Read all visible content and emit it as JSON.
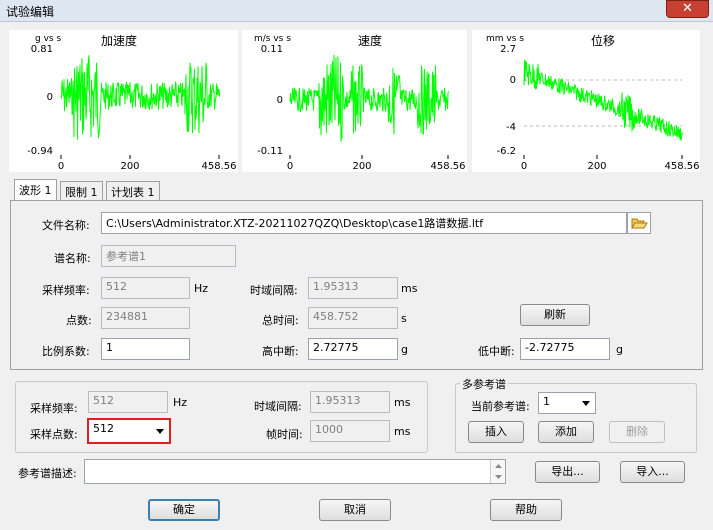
{
  "window": {
    "title": "试验编辑",
    "close_symbol": "✕"
  },
  "charts": [
    {
      "title": "加速度",
      "unit": "g vs s",
      "y_top": "0.81",
      "y_mid": "0",
      "y_bot": "-0.94",
      "x_ticks": [
        "0",
        "200",
        "458.56"
      ],
      "color": "#00ff00"
    },
    {
      "title": "速度",
      "unit": "m/s vs s",
      "y_top": "0.11",
      "y_mid": "0",
      "y_bot": "-0.11",
      "x_ticks": [
        "0",
        "200",
        "458.56"
      ],
      "color": "#00ff00"
    },
    {
      "title": "位移",
      "unit": "mm vs s",
      "y_top": "2.7",
      "y_mid": "0",
      "y_mid2": "-4",
      "y_bot": "-6.2",
      "x_ticks": [
        "0",
        "200",
        "458.56"
      ],
      "color": "#00ff00"
    }
  ],
  "tabs": [
    "波形 1",
    "限制 1",
    "计划表 1"
  ],
  "waveform": {
    "file_label": "文件名称:",
    "file_value": "C:\\Users\\Administrator.XTZ-20211027QZQ\\Desktop\\case1路谱数据.ltf",
    "spectrum_name_label": "谱名称:",
    "spectrum_name_value": "参考谱1",
    "sample_rate_label": "采样频率:",
    "sample_rate_value": "512",
    "sample_rate_unit": "Hz",
    "time_interval_label": "时域间隔:",
    "time_interval_value": "1.95313",
    "time_interval_unit": "ms",
    "points_label": "点数:",
    "points_value": "234881",
    "total_time_label": "总时间:",
    "total_time_value": "458.752",
    "total_time_unit": "s",
    "refresh_label": "刷新",
    "scale_label": "比例系数:",
    "scale_value": "1",
    "high_cut_label": "高中断:",
    "high_cut_value": "2.72775",
    "high_cut_unit": "g",
    "low_cut_label": "低中断:",
    "low_cut_value": "-2.72775",
    "low_cut_unit": "g"
  },
  "lower": {
    "sample_rate_label": "采样频率:",
    "sample_rate_value": "512",
    "sample_rate_unit": "Hz",
    "time_interval_label": "时域间隔:",
    "time_interval_value": "1.95313",
    "time_interval_unit": "ms",
    "sample_points_label": "采样点数:",
    "sample_points_value": "512",
    "frame_time_label": "帧时间:",
    "frame_time_value": "1000",
    "frame_time_unit": "ms"
  },
  "multi_ref": {
    "group_title": "多参考谱",
    "current_label": "当前参考谱:",
    "current_value": "1",
    "insert_label": "插入",
    "add_label": "添加",
    "delete_label": "删除"
  },
  "description": {
    "label": "参考谱描述:",
    "value": ""
  },
  "export_label": "导出...",
  "import_label": "导入...",
  "ok_label": "确定",
  "cancel_label": "取消",
  "help_label": "帮助"
}
